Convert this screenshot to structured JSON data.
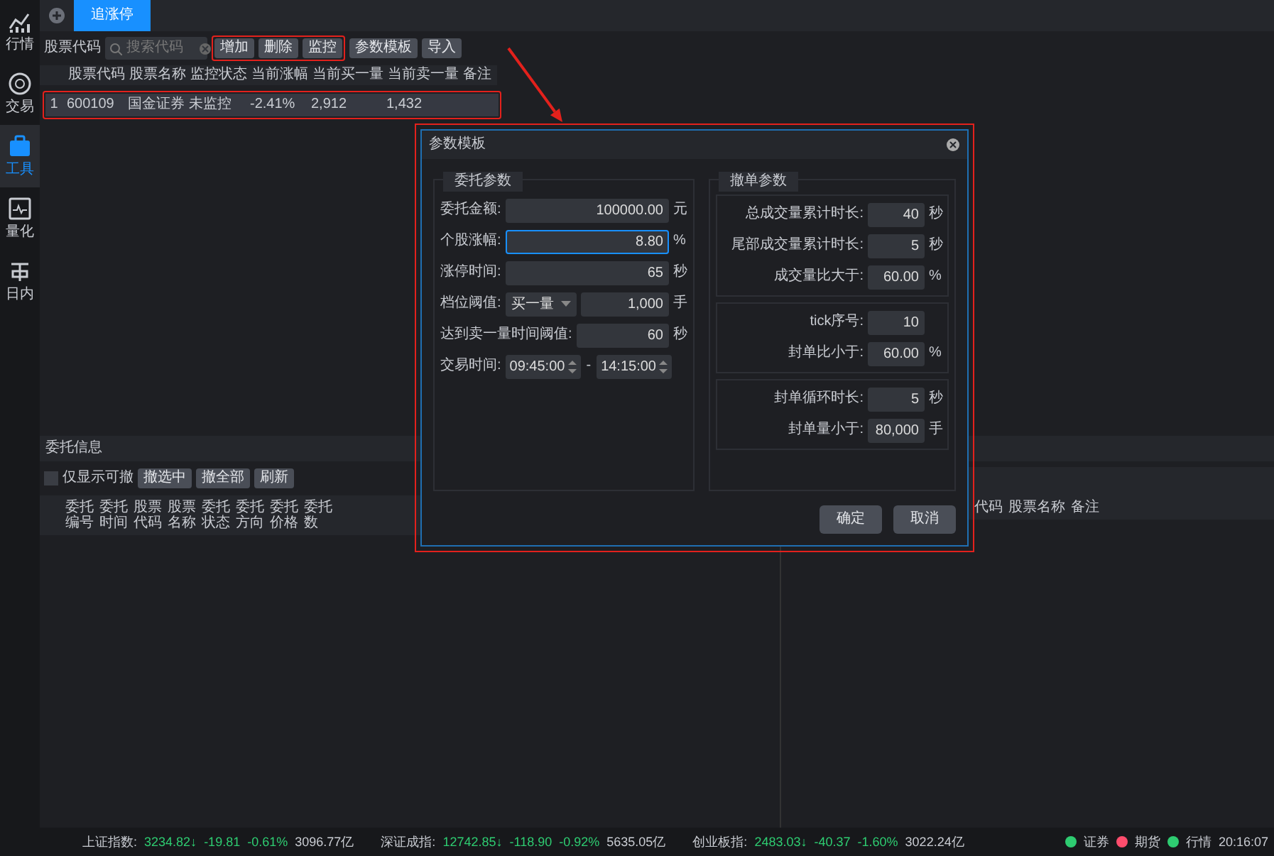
{
  "sidebar": {
    "items": [
      {
        "label": "行情",
        "selected": false
      },
      {
        "label": "交易",
        "selected": false
      },
      {
        "label": "工具",
        "selected": true
      },
      {
        "label": "量化",
        "selected": false
      },
      {
        "label": "日内",
        "selected": false
      }
    ]
  },
  "tabs": [
    {
      "label": "追涨停",
      "selected": true
    }
  ],
  "toolbar": {
    "label": "股票代码",
    "search": {
      "placeholder": "搜索代码"
    },
    "buttons": [
      "增加",
      "删除",
      "监控",
      "参数模板",
      "导入"
    ]
  },
  "table": {
    "columns": [
      "股票代码",
      "股票名称",
      "监控状态",
      "当前涨幅",
      "当前买一量",
      "当前卖一量",
      "备注"
    ],
    "rows": [
      {
        "index": "1",
        "cells": [
          "600109",
          "国金证券",
          "未监控",
          "-2.41%",
          "2,912",
          "1,432",
          ""
        ],
        "selected": true
      }
    ]
  },
  "orders_panel": {
    "title": "委托信息",
    "filter": {
      "label": "仅显示可撤",
      "checked": false
    },
    "buttons": [
      "撤选中",
      "撤全部",
      "刷新"
    ],
    "columns": [
      "委托编号",
      "委托时间",
      "股票代码",
      "股票名称",
      "委托状态",
      "委托方向",
      "委托价格",
      "委托数"
    ]
  },
  "right_panel": {
    "columns": [
      "代码",
      "股票名称",
      "备注"
    ]
  },
  "dialog": {
    "title": "参数模板",
    "order_group": {
      "title": "委托参数",
      "rows": [
        {
          "kind": "input",
          "label": "委托金额:",
          "value": "100000.00",
          "unit": "元",
          "focused": false
        },
        {
          "kind": "input",
          "label": "个股涨幅:",
          "value": "8.80",
          "unit": "%",
          "focused": true
        },
        {
          "kind": "input",
          "label": "涨停时间:",
          "value": "65",
          "unit": "秒",
          "focused": false
        },
        {
          "kind": "select",
          "label": "档位阈值:",
          "option": "买一量",
          "value": "1,000",
          "unit": "手"
        },
        {
          "kind": "input",
          "label": "达到卖一量时间阈值:",
          "value": "60",
          "unit": "秒",
          "focused": false
        },
        {
          "kind": "time_range",
          "label": "交易时间:",
          "start": "09:45:00",
          "separator": "-",
          "end": "14:15:00"
        }
      ]
    },
    "cancel_group": {
      "title": "撤单参数",
      "sections": [
        [
          {
            "label": "总成交量累计时长:",
            "value": "40",
            "unit": "秒"
          },
          {
            "label": "尾部成交量累计时长:",
            "value": "5",
            "unit": "秒"
          },
          {
            "label": "成交量比大于:",
            "value": "60.00",
            "unit": "%"
          }
        ],
        [
          {
            "label": "tick序号:",
            "value": "10"
          },
          {
            "label": "封单比小于:",
            "value": "60.00",
            "unit": "%"
          }
        ],
        [
          {
            "label": "封单循环时长:",
            "value": "5",
            "unit": "秒"
          },
          {
            "label": "封单量小于:",
            "value": "80,000",
            "unit": "手"
          }
        ]
      ]
    },
    "buttons": [
      "确定",
      "取消"
    ]
  },
  "status_bar": {
    "indices": [
      {
        "name": "上证指数:",
        "price": "3234.82↓",
        "change": "-19.81",
        "percent": "-0.61%",
        "turnover": "3096.77亿"
      },
      {
        "name": "深证成指:",
        "price": "12742.85↓",
        "change": "-118.90",
        "percent": "-0.92%",
        "turnover": "5635.05亿"
      },
      {
        "name": "创业板指:",
        "price": "2483.03↓",
        "change": "-40.37",
        "percent": "-1.60%",
        "turnover": "3022.24亿"
      }
    ],
    "connections": [
      {
        "label": "证券",
        "color": "#2ecc71"
      },
      {
        "label": "期货",
        "color": "#ff4d6d"
      },
      {
        "label": "行情",
        "color": "#2ecc71"
      }
    ],
    "time": "20:16:07"
  }
}
